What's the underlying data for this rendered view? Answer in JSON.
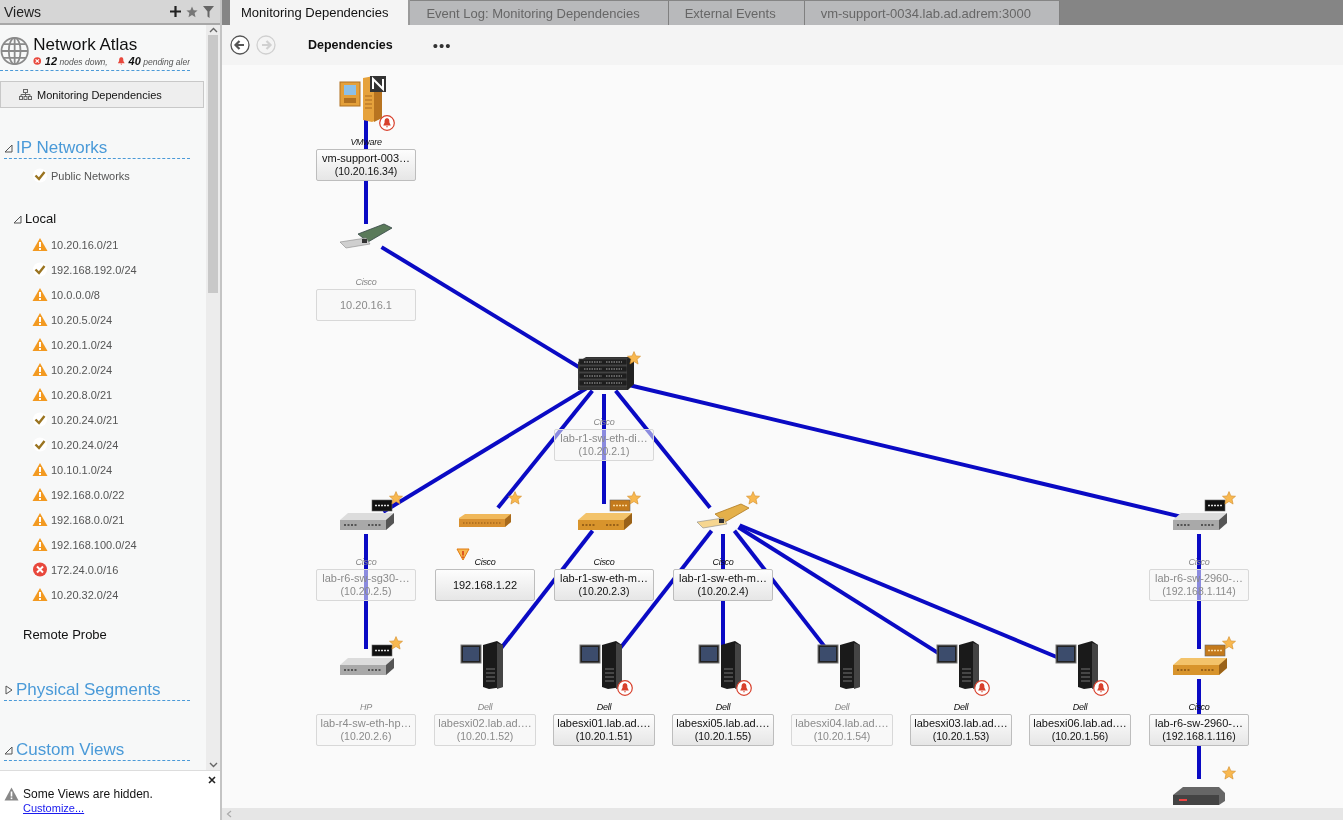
{
  "sidebar": {
    "title": "Views",
    "atlas": {
      "title": "Network Atlas",
      "nodes_down": "**12** nodes down,",
      "pending_alerts": "**40** pending aler"
    },
    "views": [
      {
        "label": "Monitoring Dependencies",
        "selected": true
      }
    ],
    "sections": [
      {
        "title": "IP Networks",
        "expanded": true,
        "items": [
          {
            "label": "Public Networks",
            "kind": "ok"
          }
        ],
        "groups": [
          {
            "title": "Local",
            "expanded": true,
            "items": [
              {
                "label": "10.20.16.0/21",
                "kind": "warning"
              },
              {
                "label": "192.168.192.0/24",
                "kind": "ok"
              },
              {
                "label": "10.0.0.0/8",
                "kind": "warning"
              },
              {
                "label": "10.20.5.0/24",
                "kind": "warning"
              },
              {
                "label": "10.20.1.0/24",
                "kind": "warning"
              },
              {
                "label": "10.20.2.0/24",
                "kind": "warning"
              },
              {
                "label": "10.20.8.0/21",
                "kind": "warning"
              },
              {
                "label": "10.20.24.0/21",
                "kind": "ok"
              },
              {
                "label": "10.20.24.0/24",
                "kind": "ok"
              },
              {
                "label": "10.10.1.0/24",
                "kind": "warning"
              },
              {
                "label": "192.168.0.0/22",
                "kind": "warning"
              },
              {
                "label": "192.168.0.0/21",
                "kind": "warning"
              },
              {
                "label": "192.168.100.0/24",
                "kind": "warning"
              },
              {
                "label": "172.24.0.0/16",
                "kind": "down"
              },
              {
                "label": "10.20.32.0/24",
                "kind": "warning"
              }
            ]
          },
          {
            "title": "Remote Probe"
          }
        ]
      },
      {
        "title": "Physical Segments",
        "expanded": false
      },
      {
        "title": "Custom Views",
        "expanded": true
      }
    ],
    "notice": {
      "text": "Some Views are hidden.",
      "link": "Customize..."
    }
  },
  "tabs": [
    {
      "label": "Monitoring Dependencies",
      "selected": true
    },
    {
      "label": "Event Log: Monitoring Dependencies",
      "selected": false
    },
    {
      "label": "External Events",
      "selected": false
    },
    {
      "label": "vm-support-0034.lab.ad.adrem:3000",
      "selected": false
    }
  ],
  "toolbar": {
    "buttons": [
      {
        "kind": "back",
        "disabled": false
      },
      {
        "kind": "forward",
        "disabled": true
      }
    ],
    "title": "Dependencies",
    "more": "•••"
  },
  "map": {
    "root": {
      "kind": "vm",
      "vendor": "VMware",
      "name": "vm-support-003…",
      "ip": "(10.20.16.34)",
      "dimmed": false,
      "starred": false,
      "alert": true,
      "warning": false,
      "children": [
        {
          "kind": "card",
          "vendor": "Cisco",
          "name": "10.20.16.1",
          "dimmed": true,
          "starred": false,
          "alert": false,
          "warning": false,
          "children": [
            {
              "kind": "stack",
              "vendor": "Cisco",
              "name": "lab-r1-sw-eth-di…",
              "ip": "(10.20.2.1)",
              "dimmed": true,
              "starred": true,
              "alert": false,
              "warning": false,
              "children": [
                {
                  "kind": "switch",
                  "vendor": "Cisco",
                  "name": "lab-r6-sw-sg30-…",
                  "ip": "(10.20.2.5)",
                  "dimmed": true,
                  "starred": true,
                  "alert": false,
                  "warning": false,
                  "children": [
                    {
                      "kind": "switch",
                      "vendor": "HP",
                      "name": "lab-r4-sw-eth-hp…",
                      "ip": "(10.20.2.6)",
                      "dimmed": true,
                      "starred": true,
                      "alert": false,
                      "warning": false
                    }
                  ]
                },
                {
                  "kind": "gold-hub",
                  "vendor": "Cisco",
                  "name": "192.168.1.22",
                  "dimmed": false,
                  "starred": true,
                  "alert": false,
                  "warning": true
                },
                {
                  "kind": "gold-switch",
                  "vendor": "Cisco",
                  "name": "lab-r1-sw-eth-m…",
                  "ip": "(10.20.2.3)",
                  "dimmed": false,
                  "starred": true,
                  "alert": false,
                  "warning": false,
                  "children": [
                    {
                      "kind": "esx",
                      "vendor": "Dell",
                      "name": "labesxi02.lab.ad.…",
                      "ip": "(10.20.1.52)",
                      "dimmed": true,
                      "starred": false,
                      "alert": false,
                      "warning": false
                    }
                  ]
                },
                {
                  "kind": "gold-card",
                  "vendor": "Cisco",
                  "name": "lab-r1-sw-eth-m…",
                  "ip": "(10.20.2.4)",
                  "dimmed": false,
                  "starred": true,
                  "alert": false,
                  "warning": false,
                  "children": [
                    {
                      "kind": "esx",
                      "vendor": "Dell",
                      "name": "labesxi01.lab.ad.…",
                      "ip": "(10.20.1.51)",
                      "dimmed": false,
                      "starred": false,
                      "alert": true,
                      "warning": false
                    },
                    {
                      "kind": "esx",
                      "vendor": "Dell",
                      "name": "labesxi05.lab.ad.…",
                      "ip": "(10.20.1.55)",
                      "dimmed": false,
                      "starred": false,
                      "alert": true,
                      "warning": false
                    },
                    {
                      "kind": "esx",
                      "vendor": "Dell",
                      "name": "labesxi04.lab.ad.…",
                      "ip": "(10.20.1.54)",
                      "dimmed": true,
                      "starred": false,
                      "alert": false,
                      "warning": false
                    },
                    {
                      "kind": "esx",
                      "vendor": "Dell",
                      "name": "labesxi03.lab.ad.…",
                      "ip": "(10.20.1.53)",
                      "dimmed": false,
                      "starred": false,
                      "alert": true,
                      "warning": false
                    },
                    {
                      "kind": "esx",
                      "vendor": "Dell",
                      "name": "labesxi06.lab.ad.…",
                      "ip": "(10.20.1.56)",
                      "dimmed": false,
                      "starred": false,
                      "alert": true,
                      "warning": false
                    }
                  ]
                },
                {
                  "kind": "switch",
                  "vendor": "Cisco",
                  "name": "lab-r6-sw-2960-…",
                  "ip": "(192.168.1.114)",
                  "dimmed": true,
                  "starred": true,
                  "alert": false,
                  "warning": false,
                  "children": [
                    {
                      "kind": "gold-switch",
                      "vendor": "Cisco",
                      "name": "lab-r6-sw-2960-…",
                      "ip": "(192.168.1.116)",
                      "dimmed": false,
                      "starred": true,
                      "alert": false,
                      "warning": false,
                      "children": [
                        {
                          "kind": "router",
                          "starred": true,
                          "alert": false,
                          "warning": false
                        }
                      ]
                    }
                  ]
                }
              ]
            }
          ]
        }
      ]
    }
  }
}
